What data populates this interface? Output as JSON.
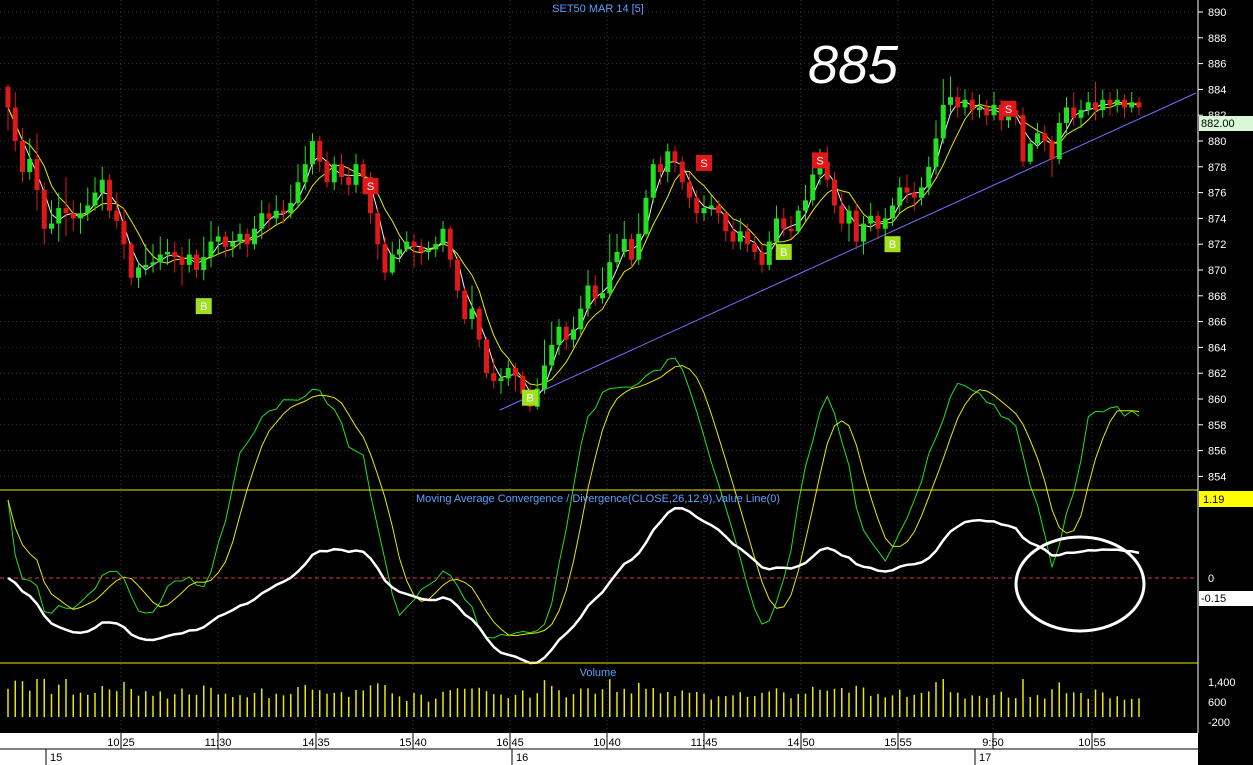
{
  "chart_data": {
    "type": "candlestick",
    "title": "SET50 MAR 14  [5]",
    "annotation": "885",
    "price_axis": {
      "ticks": [
        854,
        856,
        858,
        860,
        862,
        864,
        866,
        868,
        870,
        872,
        874,
        876,
        878,
        880,
        882,
        884,
        886,
        888,
        890
      ],
      "last_price": "882.00",
      "range": [
        852.5,
        891
      ]
    },
    "macd": {
      "title": "Moving Average Convergence / Divergence(CLOSE,26,12,9),Value Line(0)",
      "ticks": [
        "0"
      ],
      "current_value": "-0.15",
      "upper_value": "1.19"
    },
    "volume": {
      "title": "Volume",
      "ticks": [
        "1,400",
        "600",
        "-200"
      ]
    },
    "time_axis": {
      "labels": [
        "10:25",
        "11:30",
        "14:35",
        "15:40",
        "16:45",
        "10:40",
        "11:45",
        "14:50",
        "15:55",
        "9:50",
        "10:55"
      ],
      "day_labels": [
        "15",
        "16",
        "17"
      ]
    },
    "signals": [
      {
        "label": "B",
        "bar": 27,
        "price": 867.2
      },
      {
        "label": "S",
        "bar": 50,
        "price": 876.5
      },
      {
        "label": "B",
        "bar": 72,
        "price": 860.1
      },
      {
        "label": "S",
        "bar": 96,
        "price": 878.3
      },
      {
        "label": "B",
        "bar": 107,
        "price": 871.4
      },
      {
        "label": "S",
        "bar": 112,
        "price": 878.5
      },
      {
        "label": "B",
        "bar": 122,
        "price": 872
      },
      {
        "label": "S",
        "bar": 138,
        "price": 882.5
      }
    ],
    "candles": [
      [
        884.2,
        882.6,
        884.4,
        880.8
      ],
      [
        882.6,
        880.0,
        883.8,
        879.2
      ],
      [
        880.0,
        877.6,
        881.0,
        876.8
      ],
      [
        877.6,
        878.6,
        880.2,
        877.0
      ],
      [
        878.6,
        876.2,
        880.6,
        874.6
      ],
      [
        876.2,
        873.2,
        876.8,
        872.0
      ],
      [
        873.2,
        873.6,
        875.4,
        872.8
      ],
      [
        873.6,
        874.8,
        876.0,
        872.2
      ],
      [
        874.8,
        874.4,
        877.2,
        872.6
      ],
      [
        874.4,
        874.0,
        875.4,
        873.0
      ],
      [
        874.0,
        874.4,
        875.2,
        872.8
      ],
      [
        874.4,
        875.0,
        876.4,
        873.8
      ],
      [
        875.0,
        876.0,
        877.2,
        874.6
      ],
      [
        876.0,
        877.0,
        878.0,
        874.6
      ],
      [
        877.0,
        874.6,
        877.4,
        874.0
      ],
      [
        874.6,
        873.8,
        876.0,
        873.2
      ],
      [
        873.8,
        872.0,
        874.8,
        870.8
      ],
      [
        872.0,
        869.4,
        872.2,
        868.8
      ],
      [
        869.4,
        870.2,
        870.6,
        868.6
      ],
      [
        870.2,
        870.4,
        872.0,
        869.6
      ],
      [
        870.4,
        870.6,
        872.0,
        869.8
      ],
      [
        870.6,
        871.2,
        872.6,
        870.0
      ],
      [
        871.2,
        871.4,
        872.4,
        870.4
      ],
      [
        871.4,
        871.0,
        872.2,
        869.8
      ],
      [
        871.0,
        870.4,
        871.8,
        868.8
      ],
      [
        870.4,
        871.2,
        872.4,
        869.8
      ],
      [
        871.2,
        870.0,
        871.6,
        869.4
      ],
      [
        870.0,
        871.0,
        872.6,
        869.2
      ],
      [
        871.0,
        872.2,
        873.8,
        870.2
      ],
      [
        872.2,
        872.6,
        873.4,
        871.2
      ],
      [
        872.6,
        871.8,
        873.0,
        871.0
      ],
      [
        871.8,
        872.2,
        873.0,
        871.0
      ],
      [
        872.2,
        872.8,
        873.6,
        871.6
      ],
      [
        872.8,
        872.0,
        873.2,
        871.0
      ],
      [
        872.0,
        873.2,
        874.2,
        871.6
      ],
      [
        873.2,
        874.4,
        875.4,
        872.4
      ],
      [
        874.4,
        874.0,
        875.2,
        873.2
      ],
      [
        874.0,
        874.6,
        875.8,
        873.4
      ],
      [
        874.6,
        874.4,
        875.4,
        873.6
      ],
      [
        874.4,
        875.2,
        876.6,
        874.0
      ],
      [
        875.2,
        876.8,
        878.2,
        874.8
      ],
      [
        876.8,
        878.2,
        879.6,
        876.2
      ],
      [
        878.2,
        880.0,
        880.6,
        877.4
      ],
      [
        880.0,
        878.4,
        880.4,
        877.6
      ],
      [
        878.4,
        876.8,
        879.2,
        876.4
      ],
      [
        876.8,
        878.2,
        878.8,
        876.2
      ],
      [
        878.2,
        877.2,
        879.0,
        876.6
      ],
      [
        877.2,
        876.6,
        878.0,
        875.8
      ],
      [
        876.6,
        878.2,
        879.0,
        876.0
      ],
      [
        878.2,
        877.2,
        878.6,
        876.0
      ],
      [
        877.2,
        874.4,
        877.6,
        873.6
      ],
      [
        874.4,
        872.0,
        874.8,
        870.8
      ],
      [
        872.0,
        869.8,
        872.6,
        869.2
      ],
      [
        869.8,
        871.2,
        872.2,
        869.6
      ],
      [
        871.2,
        871.6,
        872.4,
        870.6
      ],
      [
        871.6,
        872.2,
        873.0,
        871.4
      ],
      [
        872.2,
        871.8,
        872.8,
        870.2
      ],
      [
        871.8,
        871.4,
        872.4,
        870.4
      ],
      [
        871.4,
        871.6,
        872.2,
        870.8
      ],
      [
        871.6,
        872.0,
        872.6,
        871.0
      ],
      [
        872.0,
        873.2,
        873.8,
        871.4
      ],
      [
        873.2,
        870.8,
        873.4,
        870.2
      ],
      [
        870.8,
        868.4,
        871.0,
        867.8
      ],
      [
        868.4,
        866.2,
        868.6,
        865.8
      ],
      [
        866.2,
        867.0,
        868.8,
        865.4
      ],
      [
        867.0,
        864.6,
        867.2,
        864.0
      ],
      [
        864.6,
        862.0,
        864.8,
        861.6
      ],
      [
        862.0,
        861.4,
        863.2,
        860.8
      ],
      [
        861.4,
        861.6,
        862.4,
        860.4
      ],
      [
        861.6,
        862.4,
        863.0,
        861.0
      ],
      [
        862.4,
        861.8,
        862.8,
        860.6
      ],
      [
        861.8,
        860.4,
        862.2,
        859.6
      ],
      [
        860.4,
        859.4,
        861.0,
        859.0
      ],
      [
        859.4,
        860.8,
        861.6,
        859.2
      ],
      [
        860.8,
        862.6,
        864.6,
        860.4
      ],
      [
        862.6,
        864.2,
        866.0,
        862.2
      ],
      [
        864.2,
        865.6,
        866.2,
        863.4
      ],
      [
        865.6,
        864.6,
        866.0,
        863.8
      ],
      [
        864.6,
        865.4,
        866.4,
        864.0
      ],
      [
        865.4,
        867.0,
        868.0,
        865.0
      ],
      [
        867.0,
        868.8,
        870.0,
        866.4
      ],
      [
        868.8,
        867.8,
        869.6,
        867.2
      ],
      [
        867.8,
        868.2,
        870.2,
        867.4
      ],
      [
        868.2,
        870.6,
        872.8,
        867.8
      ],
      [
        870.6,
        871.4,
        872.8,
        870.2
      ],
      [
        871.4,
        872.4,
        873.8,
        871.0
      ],
      [
        872.4,
        870.8,
        872.8,
        870.2
      ],
      [
        870.8,
        872.8,
        874.4,
        870.4
      ],
      [
        872.8,
        875.6,
        876.2,
        872.6
      ],
      [
        875.6,
        878.2,
        878.6,
        875.2
      ],
      [
        878.2,
        877.6,
        878.8,
        876.6
      ],
      [
        877.6,
        879.2,
        879.8,
        876.8
      ],
      [
        879.2,
        878.4,
        879.6,
        877.6
      ],
      [
        878.4,
        876.8,
        878.8,
        876.2
      ],
      [
        876.8,
        875.6,
        877.6,
        874.8
      ],
      [
        875.6,
        874.4,
        876.2,
        873.6
      ],
      [
        874.4,
        874.8,
        875.8,
        873.8
      ],
      [
        874.8,
        875.0,
        875.8,
        874.2
      ],
      [
        875.0,
        874.4,
        875.4,
        873.6
      ],
      [
        874.4,
        873.0,
        874.6,
        872.2
      ],
      [
        873.0,
        872.2,
        873.8,
        871.6
      ],
      [
        872.2,
        873.0,
        874.0,
        871.6
      ],
      [
        873.0,
        872.0,
        873.6,
        871.4
      ],
      [
        872.0,
        871.4,
        872.8,
        870.8
      ],
      [
        871.4,
        870.4,
        872.0,
        869.8
      ],
      [
        870.4,
        872.2,
        873.0,
        870.0
      ],
      [
        872.2,
        874.0,
        875.0,
        871.8
      ],
      [
        874.0,
        873.2,
        874.8,
        872.6
      ],
      [
        873.2,
        873.0,
        874.2,
        872.4
      ],
      [
        873.0,
        874.6,
        875.0,
        872.8
      ],
      [
        874.6,
        875.4,
        876.6,
        873.8
      ],
      [
        875.4,
        877.4,
        878.6,
        875.0
      ],
      [
        877.4,
        878.4,
        879.4,
        876.6
      ],
      [
        878.4,
        877.0,
        879.6,
        876.4
      ],
      [
        877.0,
        875.0,
        877.6,
        874.4
      ],
      [
        875.0,
        873.6,
        876.0,
        873.0
      ],
      [
        873.6,
        874.6,
        875.0,
        872.2
      ],
      [
        874.6,
        872.2,
        875.2,
        871.6
      ],
      [
        872.2,
        873.6,
        874.2,
        871.2
      ],
      [
        873.6,
        874.2,
        875.2,
        873.0
      ],
      [
        874.2,
        873.2,
        874.6,
        872.4
      ],
      [
        873.2,
        874.0,
        874.8,
        872.6
      ],
      [
        874.0,
        875.0,
        875.6,
        873.4
      ],
      [
        875.0,
        876.4,
        877.2,
        874.4
      ],
      [
        876.4,
        876.0,
        877.4,
        875.2
      ],
      [
        876.0,
        875.6,
        876.8,
        874.6
      ],
      [
        875.6,
        876.4,
        877.2,
        875.0
      ],
      [
        876.4,
        878.0,
        878.8,
        875.8
      ],
      [
        878.0,
        880.2,
        881.6,
        877.4
      ],
      [
        880.2,
        882.8,
        884.8,
        879.8
      ],
      [
        882.8,
        883.4,
        885.0,
        882.2
      ],
      [
        883.4,
        882.6,
        884.2,
        881.8
      ],
      [
        882.6,
        883.2,
        884.0,
        882.0
      ],
      [
        883.2,
        882.4,
        883.8,
        881.6
      ],
      [
        882.4,
        882.6,
        883.6,
        881.8
      ],
      [
        882.6,
        882.0,
        883.2,
        881.2
      ],
      [
        882.0,
        882.8,
        883.8,
        881.6
      ],
      [
        882.8,
        881.6,
        883.2,
        880.8
      ],
      [
        881.6,
        882.4,
        883.0,
        881.0
      ],
      [
        882.4,
        882.0,
        882.8,
        881.2
      ],
      [
        882.0,
        878.4,
        882.6,
        878.0
      ],
      [
        878.4,
        879.8,
        880.2,
        878.2
      ],
      [
        879.8,
        880.6,
        881.4,
        879.4
      ],
      [
        880.6,
        880.0,
        881.2,
        879.2
      ],
      [
        880.0,
        878.6,
        880.4,
        877.2
      ],
      [
        878.6,
        881.4,
        882.2,
        878.2
      ],
      [
        881.4,
        882.6,
        883.4,
        880.6
      ],
      [
        882.6,
        881.8,
        883.8,
        881.2
      ],
      [
        881.8,
        882.4,
        883.2,
        881.0
      ],
      [
        882.4,
        883.0,
        883.8,
        882.0
      ],
      [
        883.0,
        882.4,
        884.6,
        881.6
      ],
      [
        882.4,
        883.2,
        884.0,
        881.8
      ],
      [
        883.2,
        882.8,
        883.8,
        882.0
      ],
      [
        882.8,
        883.2,
        884.0,
        882.2
      ],
      [
        883.2,
        882.6,
        883.6,
        881.8
      ],
      [
        882.6,
        883.0,
        883.8,
        882.2
      ],
      [
        883.0,
        882.6,
        883.4,
        882.0
      ]
    ]
  }
}
